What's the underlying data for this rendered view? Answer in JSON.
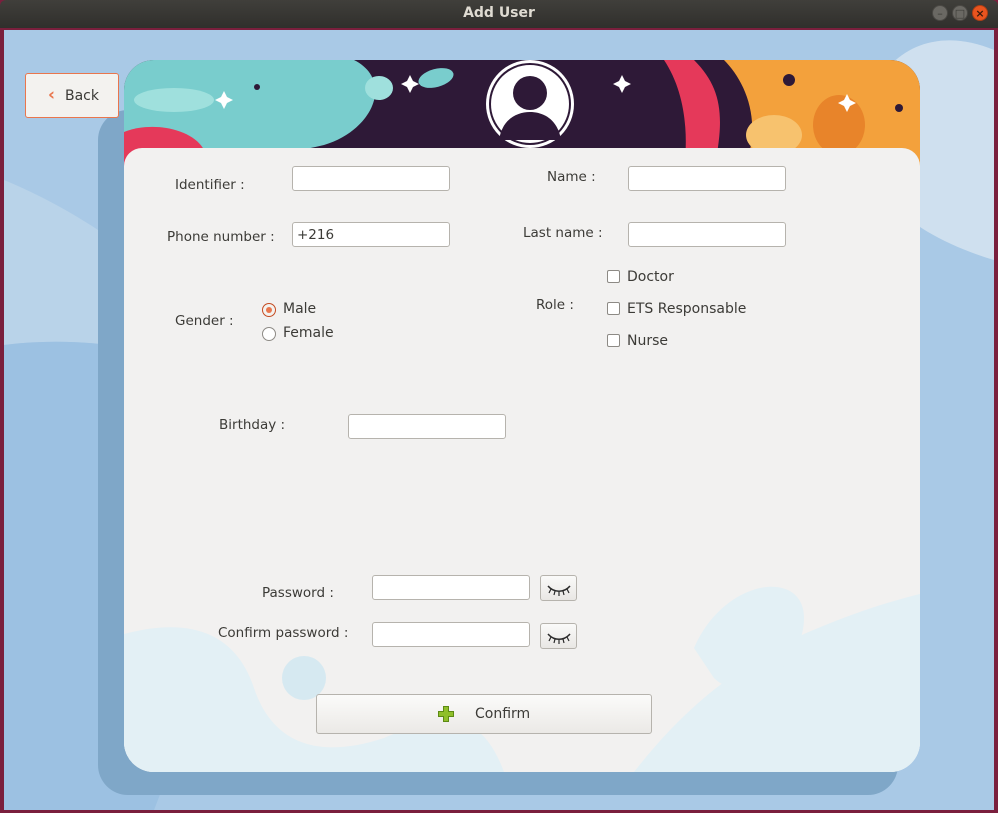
{
  "window": {
    "title": "Add User"
  },
  "nav": {
    "back_label": "Back",
    "back_icon": "chevron-left-icon"
  },
  "form": {
    "identifier": {
      "label": "Identifier  :",
      "value": ""
    },
    "name": {
      "label": "Name :",
      "value": ""
    },
    "phone": {
      "label": "Phone number :",
      "value": "+216"
    },
    "last_name": {
      "label": "Last name :",
      "value": ""
    },
    "gender": {
      "label": "Gender :",
      "options": [
        "Male",
        "Female"
      ],
      "selected": "Male"
    },
    "role": {
      "label": "Role :",
      "options": [
        "Doctor",
        "ETS Responsable",
        "Nurse"
      ]
    },
    "birthday": {
      "label": "Birthday :",
      "value": ""
    },
    "password": {
      "label": "Password :",
      "value": ""
    },
    "confirm_password": {
      "label": "Confirm password :",
      "value": ""
    }
  },
  "confirm_button": {
    "label": "Confirm",
    "icon": "plus-icon"
  },
  "colors": {
    "accent": "#e9764d",
    "card": "#f2f1f0",
    "header_purple": "#2e1937",
    "header_teal": "#79cdcd",
    "header_orange": "#f3a13c",
    "header_red": "#e5395a"
  }
}
